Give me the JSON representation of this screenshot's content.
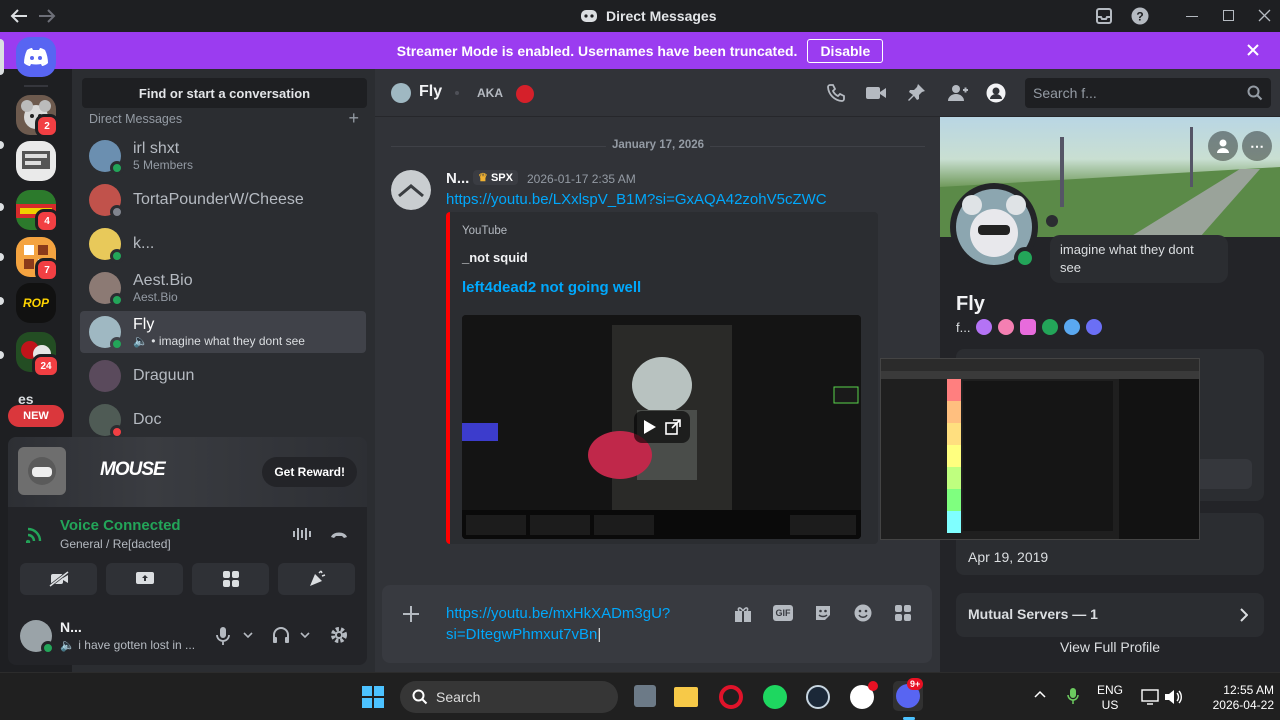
{
  "window": {
    "title": "Direct Messages"
  },
  "banner": {
    "text": "Streamer Mode is enabled. Usernames have been truncated.",
    "disable_label": "Disable"
  },
  "servers": {
    "badges": [
      "2",
      "4",
      "7",
      "24"
    ],
    "new_label": "NEW",
    "es_label": "es"
  },
  "sidebar": {
    "search_label": "Find or start a conversation",
    "section_label": "Direct Messages",
    "dms": [
      {
        "name": "irl shxt",
        "sub": "5 Members"
      },
      {
        "name": "TortaPounderW/Cheese",
        "sub": ""
      },
      {
        "name": "k...",
        "sub": ""
      },
      {
        "name": "Aest.Bio",
        "sub": "Aest.Bio"
      },
      {
        "name": "Fly",
        "sub": "• imagine what they dont see"
      },
      {
        "name": "Draguun",
        "sub": ""
      },
      {
        "name": "Doc",
        "sub": ""
      }
    ]
  },
  "promo": {
    "logo": "MOUSE",
    "button": "Get Reward!"
  },
  "voice": {
    "status": "Voice Connected",
    "channel": "General / Re[dacted]"
  },
  "user": {
    "name": "N...",
    "status": "i have gotten lost in ..."
  },
  "chat_header": {
    "name": "Fly",
    "aka": "AKA",
    "search_placeholder": "Search f..."
  },
  "chat": {
    "date_divider": "January 17, 2026",
    "message": {
      "author": "N...",
      "tag": "SPX",
      "timestamp": "2026-01-17 2:35 AM",
      "link": "https://youtu.be/LXxlspV_B1M?si=GxAQA42zohV5cZWC",
      "embed": {
        "provider": "YouTube",
        "author": "_not squid",
        "title": "left4dead2 not going well"
      }
    },
    "composer_text": "https://youtu.be/mxHkXADm3gU?si=DItegwPhmxut7vBn"
  },
  "profile": {
    "bubble": "imagine what they dont see",
    "name": "Fly",
    "handle": "f...",
    "member_since": "Apr 19, 2019",
    "mutual_servers": "Mutual Servers — 1",
    "view_full": "View Full Profile"
  },
  "taskbar": {
    "search": "Search",
    "lang_top": "ENG",
    "lang_bottom": "US",
    "time": "12:55 AM",
    "date": "2026-04-22",
    "discord_badge": "9+"
  },
  "colors": {
    "accent": "#5865f2",
    "streamer": "#9b3cf0",
    "online": "#23a559",
    "link": "#00a8fc",
    "danger": "#f23f43"
  }
}
